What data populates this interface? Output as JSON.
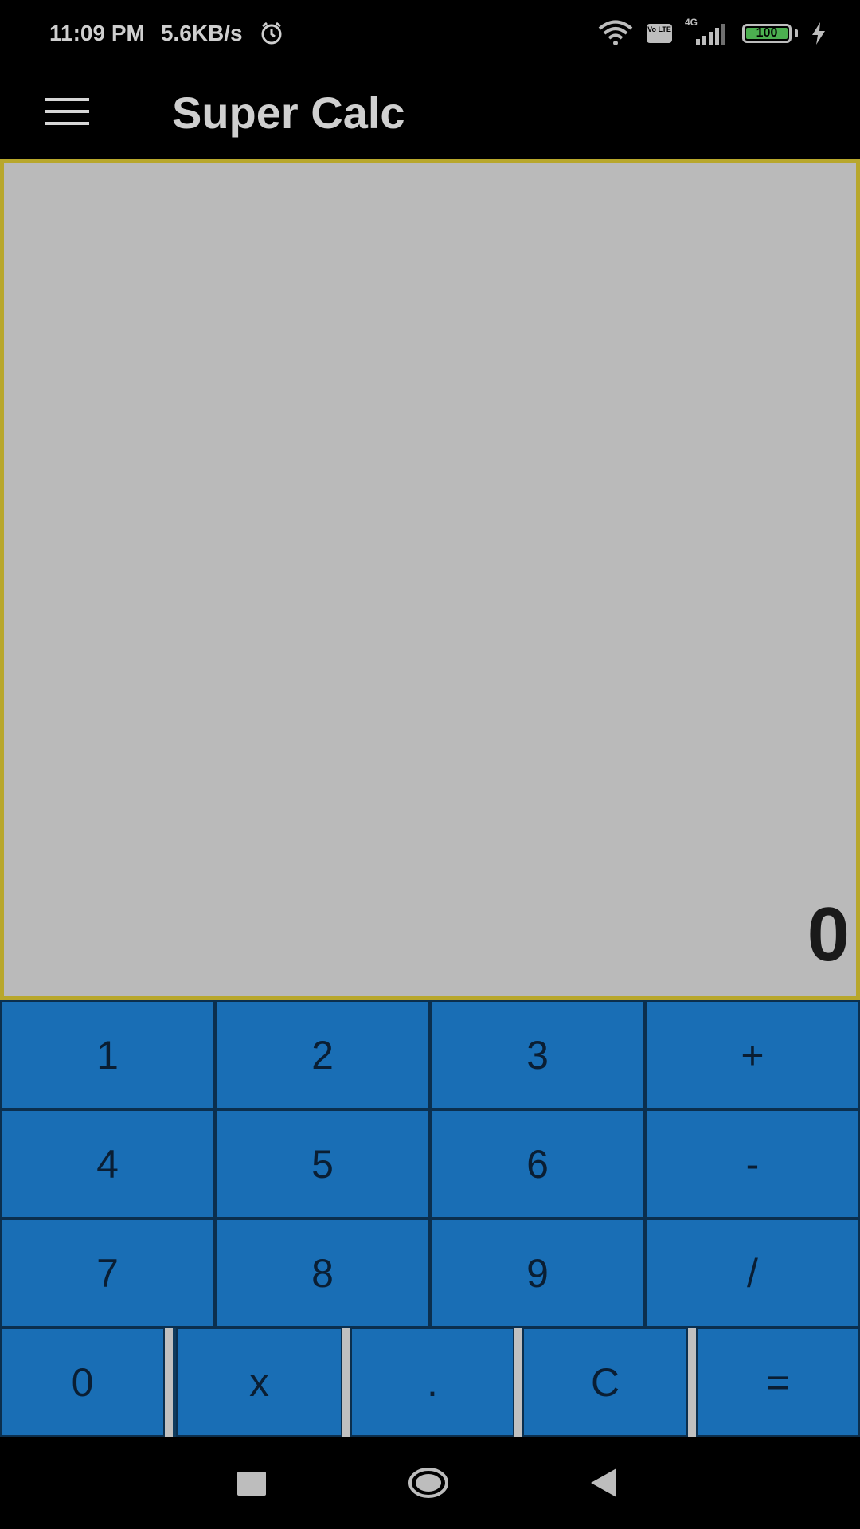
{
  "status_bar": {
    "time": "11:09 PM",
    "net_speed": "5.6KB/s",
    "icons": [
      "alarm-icon",
      "wifi-icon",
      "volte-icon",
      "signal-icon",
      "battery-icon",
      "charging-icon"
    ],
    "volte_label": "Vo LTE",
    "network_type": "4G",
    "battery_level": "100"
  },
  "app_bar": {
    "menu_icon": "hamburger-menu-icon",
    "title": "Super Calc"
  },
  "display": {
    "value": "0"
  },
  "keypad": {
    "rows": [
      [
        "1",
        "2",
        "3",
        "+"
      ],
      [
        "4",
        "5",
        "6",
        "-"
      ],
      [
        "7",
        "8",
        "9",
        "/"
      ],
      [
        "0",
        "x",
        ".",
        "C",
        "="
      ]
    ]
  },
  "nav_bar": {
    "icons": [
      "recent-apps-icon",
      "home-icon",
      "back-icon"
    ]
  },
  "colors": {
    "key_bg": "#196eb5",
    "display_bg": "#bababa",
    "display_border": "#b8a72c"
  }
}
